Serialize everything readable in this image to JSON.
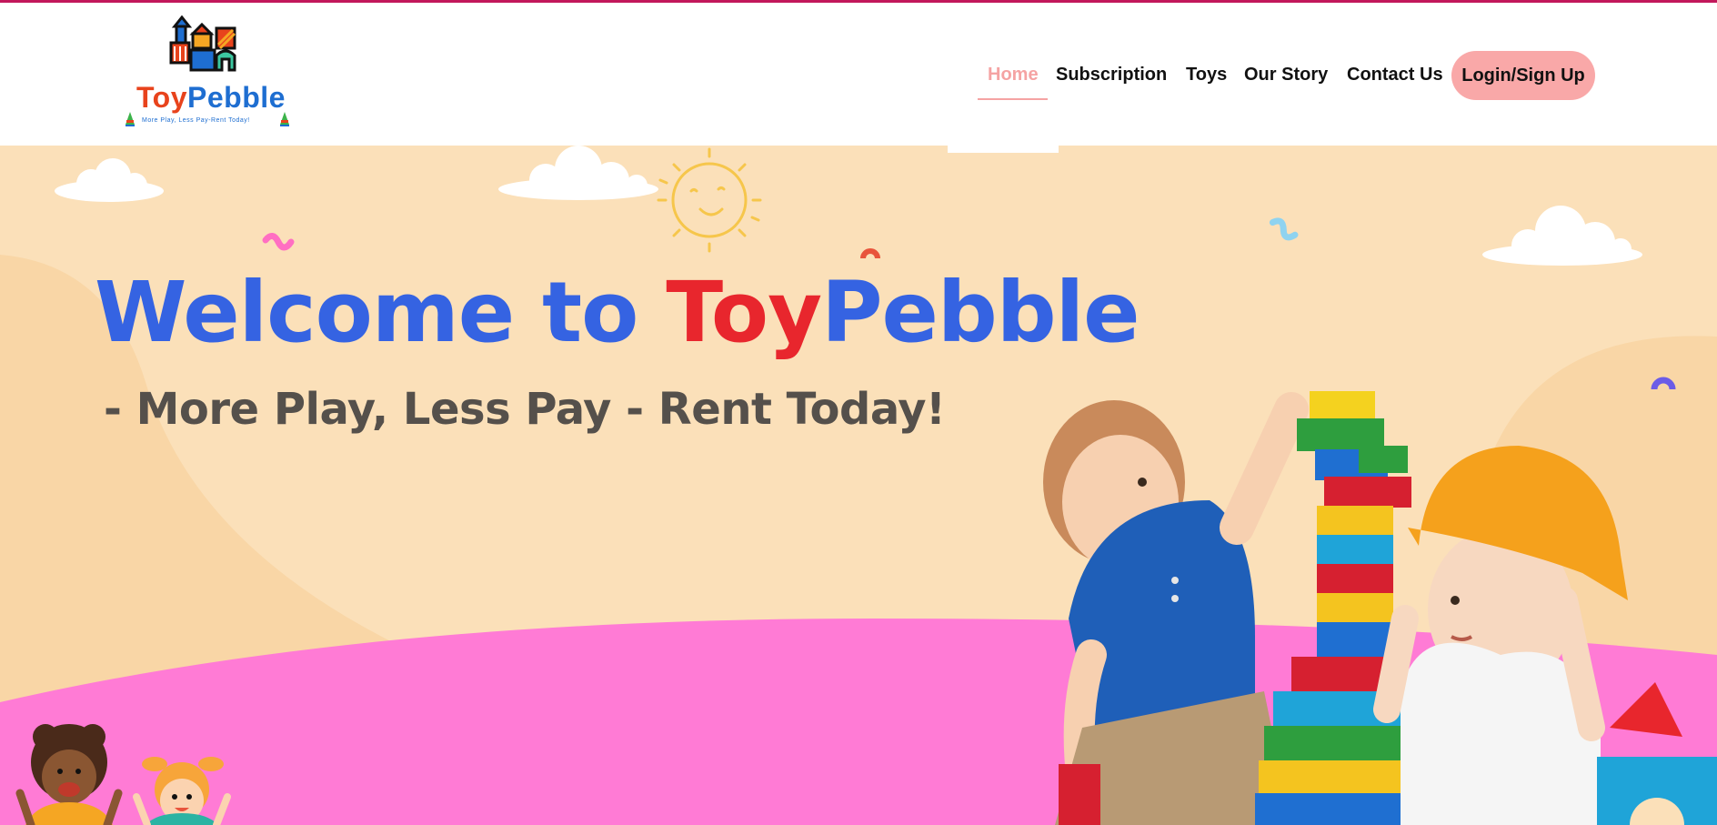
{
  "brand": {
    "name_part1": "Toy",
    "name_part2": "Pebble",
    "tagline": "More Play, Less Pay-Rent Today!"
  },
  "nav": {
    "items": [
      {
        "label": "Home",
        "active": true
      },
      {
        "label": "Subscription",
        "active": false
      },
      {
        "label": "Toys",
        "active": false
      },
      {
        "label": "Our Story",
        "active": false
      },
      {
        "label": "Contact Us",
        "active": false
      }
    ],
    "login_label": "Login/Sign Up"
  },
  "hero": {
    "headline_part1": "Welcome to",
    "headline_part2": "Toy",
    "headline_part3": "Pebble",
    "subheadline": "- More Play, Less Pay - Rent Today!"
  },
  "colors": {
    "accent_pink": "#f9a8a8",
    "headline_blue": "#3563e2",
    "headline_red": "#e8262d",
    "hero_bg": "#fbe0b9",
    "ground_pink": "#ff7bd5",
    "top_border": "#c2185b"
  },
  "icons": [
    "cloud-icon",
    "sun-icon",
    "confetti-icon",
    "kids-illustration",
    "toy-blocks-photo"
  ]
}
